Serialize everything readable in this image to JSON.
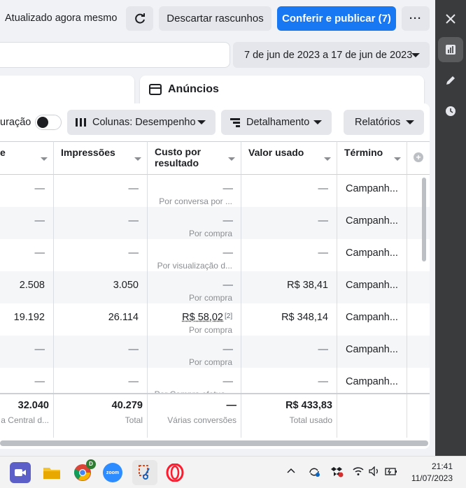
{
  "header": {
    "status_text": "Atualizado agora mesmo",
    "discard_label": "Descartar rascunhos",
    "publish_label": "Conferir e publicar (7)",
    "more_label": "···"
  },
  "date_range": "7 de jun de 2023 a 17 de jun de 2023",
  "panel": {
    "title": "Anúncios"
  },
  "toolbar": {
    "config_label": "uração",
    "columns_label": "Colunas: Desempenho",
    "breakdown_label": "Detalhamento",
    "reports_label": "Relatórios"
  },
  "table": {
    "headers": {
      "c0": "e",
      "impressions": "Impressões",
      "cost_per_result": "Custo por resultado",
      "amount_spent": "Valor usado",
      "end": "Término"
    },
    "rows": [
      {
        "c0": "—",
        "impressions": "—",
        "cost": "—",
        "cost_sub": "Por conversa por ...",
        "spent": "—",
        "end": "Campanh..."
      },
      {
        "c0": "—",
        "impressions": "—",
        "cost": "—",
        "cost_sub": "Por compra",
        "spent": "—",
        "end": "Campanh..."
      },
      {
        "c0": "—",
        "impressions": "—",
        "cost": "—",
        "cost_sub": "Por visualização d...",
        "spent": "—",
        "end": "Campanh..."
      },
      {
        "c0": "2.508",
        "impressions": "3.050",
        "cost": "—",
        "cost_sub": "Por compra",
        "spent": "R$ 38,41",
        "end": "Campanh..."
      },
      {
        "c0": "19.192",
        "impressions": "26.114",
        "cost": "R$ 58,02",
        "cost_note": "[2]",
        "cost_sub": "Por compra",
        "spent": "R$ 348,14",
        "end": "Campanh..."
      },
      {
        "c0": "—",
        "impressions": "—",
        "cost": "—",
        "cost_sub": "Por compra",
        "spent": "—",
        "end": "Campanh..."
      },
      {
        "c0": "—",
        "impressions": "—",
        "cost": "—",
        "cost_sub": "Por Compra efetua...",
        "spent": "—",
        "end": "Campanh..."
      }
    ],
    "totals": {
      "c0": "32.040",
      "c0_sub": "a Central d...",
      "impressions": "40.279",
      "impressions_sub": "Total",
      "cost": "—",
      "cost_sub": "Várias conversões",
      "spent": "R$ 433,83",
      "spent_sub": "Total usado"
    }
  },
  "taskbar": {
    "time": "21:41",
    "date": "11/07/2023",
    "zoom_label": "zoom",
    "chrome_badge": "D"
  },
  "colors": {
    "accent": "#1877f2",
    "sidebar": "#3a3b3c"
  }
}
